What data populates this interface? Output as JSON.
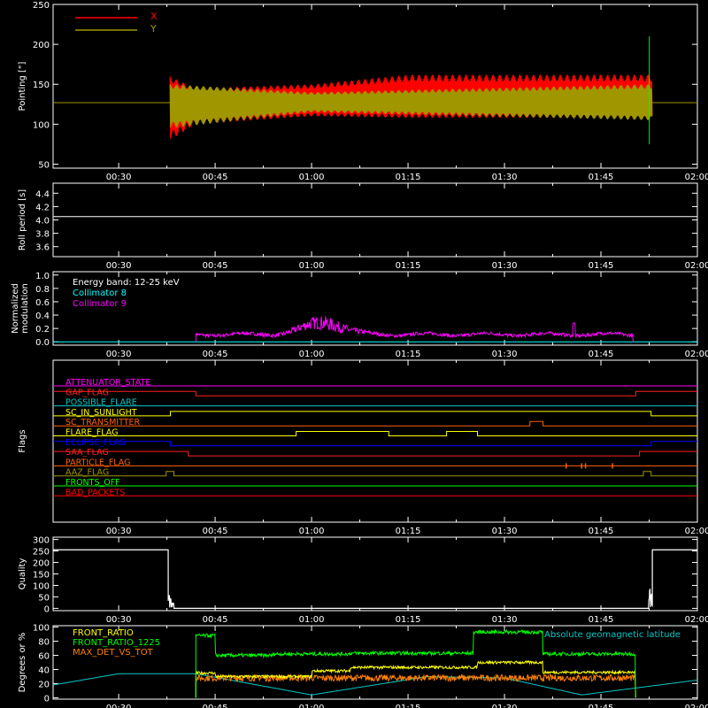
{
  "colors": {
    "background": "#000000",
    "axes": "#ffffff",
    "x_series": "#ff0000",
    "y_series": "#a09600",
    "collimator_8": "#00ffff",
    "collimator_9": "#ff00ff",
    "front_ratio": "#ffff00",
    "front_ratio_1225": "#00ff00",
    "max_det_vs_tot": "#ff8000",
    "geomag": "#00c8c8"
  },
  "chart_data": [
    {
      "type": "line",
      "name": "pointing",
      "ylabel": "Pointing [\"]",
      "xlim_hours": [
        0.33,
        2.0
      ],
      "x_tick_labels": [
        "00:30",
        "00:45",
        "01:00",
        "01:15",
        "01:30",
        "01:45",
        "02:00"
      ],
      "ylim": [
        45,
        250
      ],
      "y_ticks": [
        50,
        100,
        150,
        200,
        250
      ],
      "legend": [
        "X",
        "Y"
      ],
      "legend_placement": "top-left",
      "series": [
        {
          "name": "X",
          "start": "00:38",
          "end": "01:53",
          "envelope_upper": [
            [
              0.633,
              160
            ],
            [
              0.7,
              145
            ],
            [
              1.0,
              150
            ],
            [
              1.25,
              162
            ],
            [
              1.88,
              162
            ]
          ],
          "envelope_lower": [
            [
              0.633,
              80
            ],
            [
              0.7,
              100
            ],
            [
              1.0,
              110
            ],
            [
              1.25,
              108
            ],
            [
              1.88,
              108
            ]
          ]
        },
        {
          "name": "Y",
          "start": "00:38",
          "end": "01:53",
          "envelope_upper": [
            [
              0.633,
              150
            ],
            [
              1.0,
              140
            ],
            [
              1.88,
              150
            ]
          ],
          "envelope_lower": [
            [
              0.633,
              95
            ],
            [
              1.0,
              115
            ],
            [
              1.88,
              105
            ]
          ]
        }
      ],
      "baseline": 127
    },
    {
      "type": "line",
      "name": "roll-period",
      "ylabel": "Roll period [s]",
      "ylim": [
        3.45,
        4.55
      ],
      "y_ticks": [
        3.6,
        3.8,
        4.0,
        4.2,
        4.4
      ],
      "y_tick_labels": [
        "3.6",
        "3.8",
        "4.0",
        "4.2",
        "4.4"
      ],
      "value": 4.05
    },
    {
      "type": "line",
      "name": "modulation",
      "ylabel": "Normalized modulation",
      "ylim": [
        -0.05,
        1.05
      ],
      "y_ticks": [
        0.0,
        0.2,
        0.4,
        0.6,
        0.8,
        1.0
      ],
      "y_tick_labels": [
        "0.0",
        "0.2",
        "0.4",
        "0.6",
        "0.8",
        "1.0"
      ],
      "legend": [
        "Energy band: 12-25 keV",
        "Collimator 8",
        "Collimator 9"
      ],
      "data_start": "00:42",
      "data_end": "01:50"
    },
    {
      "type": "line",
      "name": "flags",
      "ylabel": "Flags",
      "flags": [
        {
          "label": "ATTENUATOR_STATE",
          "color": "#ff00ff",
          "steps": []
        },
        {
          "label": "GAP_FLAG",
          "color": "#ff2020",
          "steps": [
            [
              0.33,
              1
            ],
            [
              0.7,
              0
            ],
            [
              1.84,
              1
            ]
          ]
        },
        {
          "label": "POSSIBLE_FLARE",
          "color": "#00c8c8",
          "steps": []
        },
        {
          "label": "SC_IN_SUNLIGHT",
          "color": "#ffff00",
          "steps": [
            [
              0.33,
              0
            ],
            [
              0.633,
              1
            ],
            [
              1.88,
              0
            ]
          ]
        },
        {
          "label": "SC_TRANSMITTER",
          "color": "#ff6000",
          "steps": [
            [
              0.33,
              0
            ],
            [
              1.565,
              1
            ],
            [
              1.6,
              0
            ]
          ]
        },
        {
          "label": "FLARE_FLAG",
          "color": "#ffff00",
          "steps": [
            [
              0.33,
              0
            ],
            [
              0.96,
              1
            ],
            [
              1.2,
              0
            ],
            [
              1.35,
              1
            ],
            [
              1.43,
              0
            ]
          ]
        },
        {
          "label": "ECLIPSE_FLAG",
          "color": "#0000ff",
          "steps": [
            [
              0.33,
              1
            ],
            [
              0.633,
              0
            ],
            [
              1.88,
              1
            ]
          ]
        },
        {
          "label": "SAA_FLAG",
          "color": "#ff2020",
          "steps": [
            [
              0.33,
              1
            ],
            [
              0.68,
              0
            ],
            [
              1.85,
              1
            ]
          ]
        },
        {
          "label": "PARTICLE_FLAG",
          "color": "#ff6000",
          "spikes": [
            1.66,
            1.7,
            1.71,
            1.78
          ]
        },
        {
          "label": "AAZ_FLAG",
          "color": "#a09600",
          "pulses": [
            [
              0.623,
              0.643
            ],
            [
              1.86,
              1.88
            ]
          ]
        },
        {
          "label": "FRONTS_OFF",
          "color": "#00ff00",
          "steps": []
        },
        {
          "label": "BAD_PACKETS",
          "color": "#ff0000",
          "steps": []
        }
      ]
    },
    {
      "type": "line",
      "name": "quality",
      "ylabel": "Quality",
      "ylim": [
        -10,
        310
      ],
      "y_ticks": [
        0,
        50,
        100,
        150,
        200,
        250,
        300
      ],
      "high_value": 255,
      "low_from": "00:38",
      "low_to": "01:53"
    },
    {
      "type": "line",
      "name": "ratios",
      "ylabel": "Degrees or %",
      "ylim": [
        -2,
        102
      ],
      "y_ticks": [
        0,
        20,
        40,
        60,
        80,
        100
      ],
      "legend": [
        "FRONT_RATIO",
        "FRONT_RATIO_1225",
        "MAX_DET_VS_TOT"
      ],
      "annotation": "Absolute geomagnetic latitude",
      "front_ratio_1225": [
        [
          0.7,
          88
        ],
        [
          0.75,
          60
        ],
        [
          0.9,
          62
        ],
        [
          1.1,
          63
        ],
        [
          1.4,
          63
        ],
        [
          1.42,
          93
        ],
        [
          1.6,
          62
        ],
        [
          1.84,
          62
        ]
      ],
      "front_ratio": [
        [
          0.7,
          35
        ],
        [
          0.75,
          30
        ],
        [
          1.0,
          38
        ],
        [
          1.1,
          43
        ],
        [
          1.42,
          43
        ],
        [
          1.43,
          50
        ],
        [
          1.6,
          36
        ],
        [
          1.84,
          33
        ]
      ],
      "max_det_vs_tot": [
        [
          0.7,
          28
        ],
        [
          1.84,
          28
        ]
      ],
      "geomag": [
        [
          0.33,
          18
        ],
        [
          0.5,
          34
        ],
        [
          0.7,
          34
        ],
        [
          1.0,
          4
        ],
        [
          1.3,
          30
        ],
        [
          1.5,
          28
        ],
        [
          1.7,
          4
        ],
        [
          2.0,
          25
        ]
      ]
    }
  ]
}
